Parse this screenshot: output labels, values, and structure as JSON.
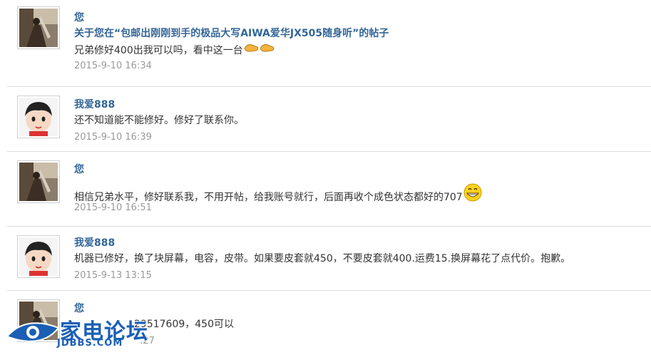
{
  "messages": [
    {
      "author": "您",
      "subject": "关于您在“包邮出刚刚到手的极品大写AIWA爱华JX505随身听”的帖子",
      "text": "兄弟修好400出我可以吗，看中这一台",
      "emoticon": "handshake-icon",
      "time": "2015-9-10 16:34"
    },
    {
      "author": "我爱888",
      "text": "还不知道能不能修好。修好了联系你。",
      "time": "2015-9-10 16:39"
    },
    {
      "author": "您",
      "text": "相信兄弟水平，修好联系我，不用开帖，给我账号就行，后面再收个成色状态都好的707",
      "emoticon": "grin-icon",
      "time": "2015-9-10 16:51"
    },
    {
      "author": "我爱888",
      "text": "机器已修好，换了块屏幕，电容，皮带。如果要皮套就450，不要皮套就400.运费15.换屏幕花了点代价。抱歉。",
      "time": "2015-9-13 13:15"
    },
    {
      "author": "您",
      "text": "29517609，450可以",
      "time": ":27"
    }
  ],
  "watermark": {
    "name": "家电论坛",
    "url": "JDBBS.COM"
  },
  "colors": {
    "author": "#336699",
    "time": "#999999",
    "divider": "#dcdcdc",
    "watermark": "#1a5fb4"
  }
}
